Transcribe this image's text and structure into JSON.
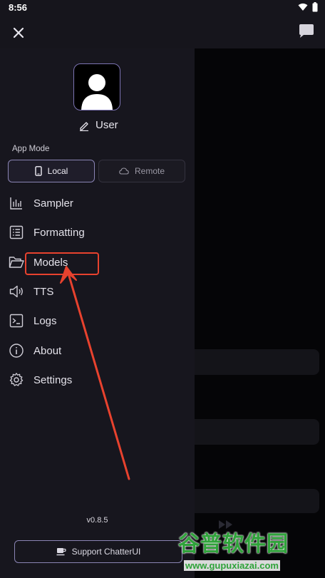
{
  "status_bar": {
    "time": "8:56"
  },
  "profile": {
    "user_name": "User"
  },
  "app_mode": {
    "label": "App Mode",
    "options": [
      {
        "label": "Local",
        "selected": true
      },
      {
        "label": "Remote",
        "selected": false
      }
    ]
  },
  "menu": {
    "items": [
      {
        "label": "Sampler",
        "icon": "bar-chart-icon"
      },
      {
        "label": "Formatting",
        "icon": "list-icon"
      },
      {
        "label": "Models",
        "icon": "folder-open-icon"
      },
      {
        "label": "TTS",
        "icon": "speaker-icon"
      },
      {
        "label": "Logs",
        "icon": "terminal-icon"
      },
      {
        "label": "About",
        "icon": "info-icon"
      },
      {
        "label": "Settings",
        "icon": "gear-icon"
      }
    ]
  },
  "footer": {
    "version": "v0.8.5",
    "support_label": "Support ChatterUI"
  },
  "watermark": {
    "text": "谷普软件园",
    "url": "www.gupuxiazai.com"
  },
  "colors": {
    "annotation": "#e8422e",
    "accent": "#8a84b4",
    "drawer_bg": "#17161e"
  }
}
